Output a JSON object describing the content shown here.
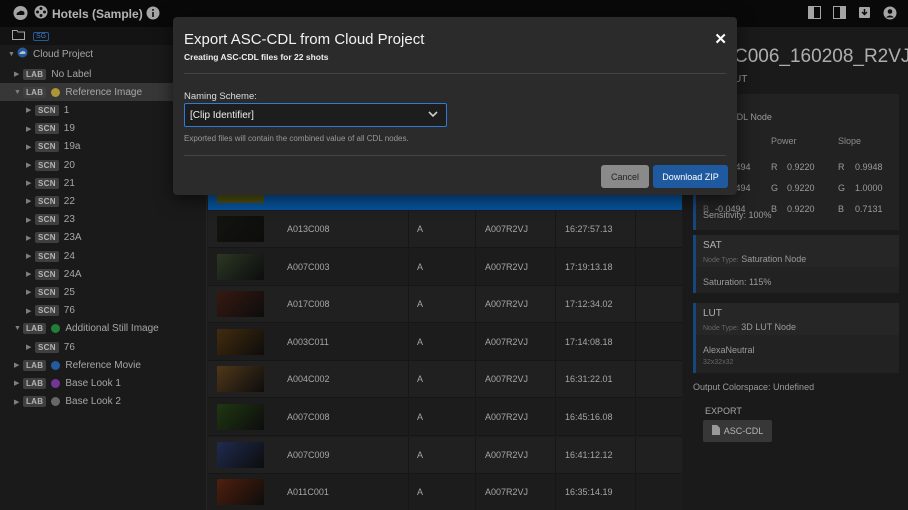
{
  "header": {
    "project_title": "Hotels (Sample)",
    "icons": [
      "cloud-logo-icon",
      "info-icon",
      "layout-left-icon",
      "layout-right-icon",
      "download-icon",
      "user-icon"
    ]
  },
  "sidebar": {
    "root_label": "Cloud Project",
    "badge_folder": "SG",
    "badges": {
      "lab": "LAB",
      "scn": "SCN"
    },
    "items": [
      {
        "type": "lab",
        "label": "No Label"
      },
      {
        "type": "lab",
        "label": "Reference Image",
        "color": "#e6c84a",
        "selected": true
      },
      {
        "type": "scn",
        "label": "1"
      },
      {
        "type": "scn",
        "label": "19"
      },
      {
        "type": "scn",
        "label": "19a"
      },
      {
        "type": "scn",
        "label": "20"
      },
      {
        "type": "scn",
        "label": "21"
      },
      {
        "type": "scn",
        "label": "22"
      },
      {
        "type": "scn",
        "label": "23"
      },
      {
        "type": "scn",
        "label": "23A"
      },
      {
        "type": "scn",
        "label": "24"
      },
      {
        "type": "scn",
        "label": "24A"
      },
      {
        "type": "scn",
        "label": "25"
      },
      {
        "type": "scn",
        "label": "76"
      },
      {
        "type": "lab",
        "label": "Additional Still Image",
        "color": "#2ea84a"
      },
      {
        "type": "scn",
        "label": "76"
      },
      {
        "type": "lab",
        "label": "Reference Movie",
        "color": "#2f7ad6"
      },
      {
        "type": "lab",
        "label": "Base Look 1",
        "color": "#9b48c8"
      },
      {
        "type": "lab",
        "label": "Base Look 2",
        "color": "#8a8a8a"
      }
    ]
  },
  "table": {
    "rows": [
      {
        "clip": "A013C008",
        "cam": "A",
        "roll": "A007R2VJ",
        "tc": "16:27:57.13",
        "thumb": "#1a1a14"
      },
      {
        "clip": "A007C003",
        "cam": "A",
        "roll": "A007R2VJ",
        "tc": "17:19:13.18",
        "thumb": "#3a4a30"
      },
      {
        "clip": "A017C008",
        "cam": "A",
        "roll": "A007R2VJ",
        "tc": "17:12:34.02",
        "thumb": "#4a2218"
      },
      {
        "clip": "A003C011",
        "cam": "A",
        "roll": "A007R2VJ",
        "tc": "17:14:08.18",
        "thumb": "#5a3a12"
      },
      {
        "clip": "A004C002",
        "cam": "A",
        "roll": "A007R2VJ",
        "tc": "16:31:22.01",
        "thumb": "#6a4a22"
      },
      {
        "clip": "A007C008",
        "cam": "A",
        "roll": "A007R2VJ",
        "tc": "16:45:16.08",
        "thumb": "#2a4a18"
      },
      {
        "clip": "A007C009",
        "cam": "A",
        "roll": "A007R2VJ",
        "tc": "16:41:12.12",
        "thumb": "#2a3a6a"
      },
      {
        "clip": "A011C001",
        "cam": "A",
        "roll": "A007R2VJ",
        "tc": "16:35:14.19",
        "thumb": "#6a2a12"
      }
    ]
  },
  "right_panel": {
    "title_partial": "C006_160208_R2VJ",
    "subtitle_partial": "UT",
    "cdl": {
      "node_type_partial": "e:",
      "node_type": "CDL Node",
      "power_label": "Power",
      "slope_label": "Slope",
      "rows": [
        {
          "offset": ".0494",
          "p_ch": "R",
          "power": "0.9220",
          "s_ch": "R",
          "slope": "0.9948"
        },
        {
          "offset": ".0494",
          "p_ch": "G",
          "power": "0.9220",
          "s_ch": "G",
          "slope": "1.0000"
        },
        {
          "offset": "-0.0494",
          "off_ch": "B",
          "p_ch": "B",
          "power": "0.9220",
          "s_ch": "B",
          "slope": "0.7131"
        }
      ],
      "sensitivity": "Sensitivity: 100%"
    },
    "sat": {
      "title": "SAT",
      "node_type_label": "Node Type:",
      "node_type": "Saturation Node",
      "saturation": "Saturation: 115%"
    },
    "lut": {
      "title": "LUT",
      "node_type_label": "Node Type:",
      "node_type": "3D LUT Node",
      "lut_name": "AlexaNeutral",
      "lut_size": "32x32x32"
    },
    "output_colorspace": "Output Colorspace: Undefined",
    "export_label": "EXPORT",
    "export_button": "ASC-CDL"
  },
  "modal": {
    "title": "Export ASC-CDL from Cloud Project",
    "subtitle": "Creating ASC-CDL files for 22 shots",
    "naming_label": "Naming Scheme:",
    "naming_value": "[Clip Identifier]",
    "note": "Exported files will contain the combined value of all CDL nodes.",
    "cancel": "Cancel",
    "download": "Download ZIP"
  },
  "colors": {
    "accent": "#1f5aa0",
    "selection": "#0a6fd0"
  }
}
